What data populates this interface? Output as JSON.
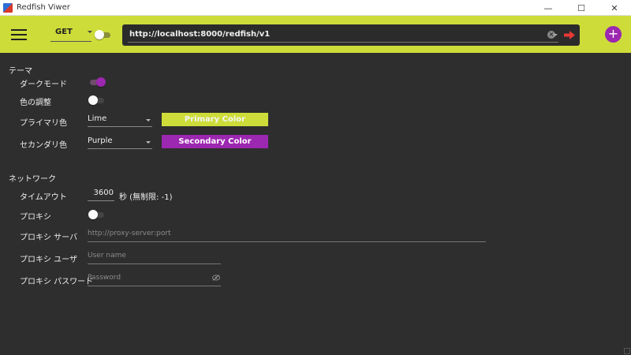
{
  "window": {
    "title": "Redfish Viwer"
  },
  "window_controls": {
    "minimize": "—",
    "maximize": "☐",
    "close": "✕"
  },
  "appbar": {
    "method": "GET",
    "url": "http://localhost:8000/redfish/v1",
    "add_label": "+"
  },
  "theme": {
    "section_title": "テーマ",
    "dark_mode_label": "ダークモード",
    "dark_mode_on": true,
    "color_adjust_label": "色の調整",
    "color_adjust_on": false,
    "primary_label": "プライマリ色",
    "primary_value": "Lime",
    "primary_button": "Primary Color",
    "primary_color": "#cddc39",
    "secondary_label": "セカンダリ色",
    "secondary_value": "Purple",
    "secondary_button": "Secondary Color",
    "secondary_color": "#9c27b0"
  },
  "network": {
    "section_title": "ネットワーク",
    "timeout_label": "タイムアウト",
    "timeout_value": "3600",
    "timeout_unit": "秒 (無制限: -1)",
    "proxy_label": "プロキシ",
    "proxy_on": false,
    "proxy_server_label": "プロキシ サーバ",
    "proxy_server_placeholder": "http://proxy-server:port",
    "proxy_user_label": "プロキシ ユーザ",
    "proxy_user_placeholder": "User name",
    "proxy_password_label": "プロキシ パスワード",
    "proxy_password_placeholder": "Password"
  },
  "icons": {
    "menu": "hamburger-menu-icon",
    "clear": "clear-circle-icon",
    "send": "send-arrow-icon",
    "add": "add-plus-icon",
    "eye": "eye-off-icon"
  }
}
